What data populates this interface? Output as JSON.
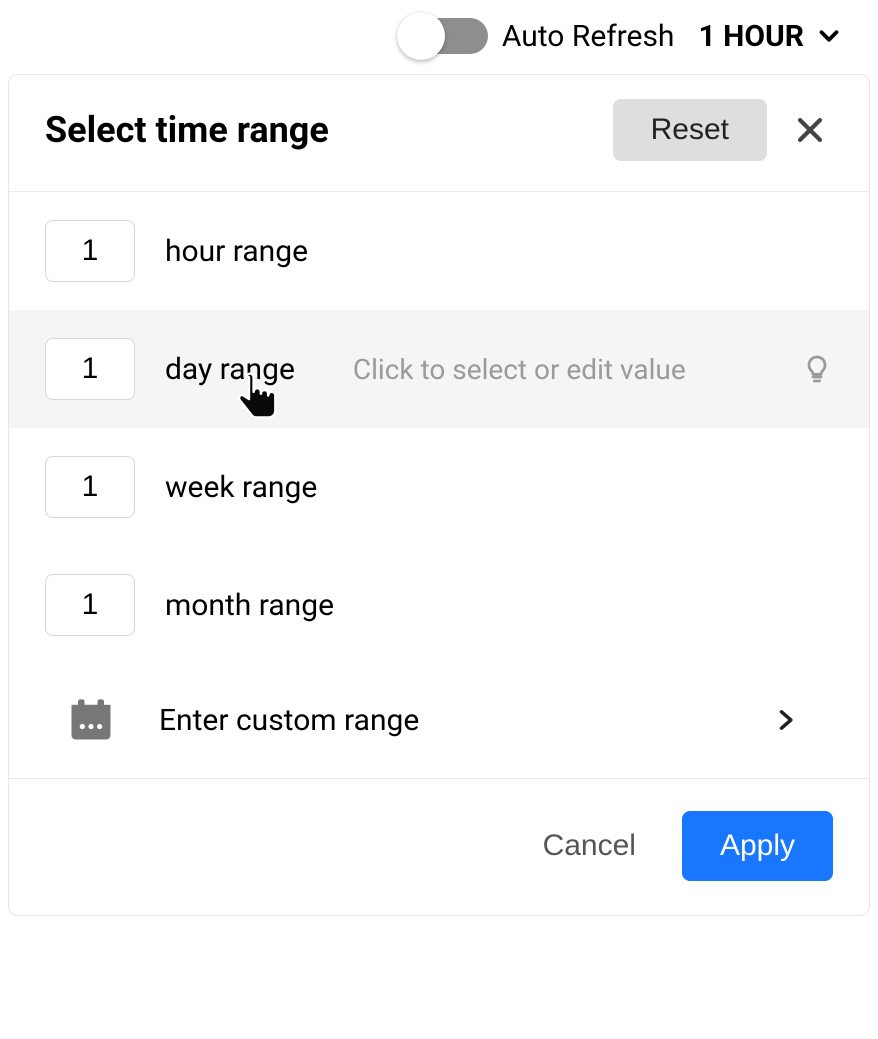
{
  "topbar": {
    "auto_refresh_label": "Auto Refresh",
    "auto_refresh_on": false,
    "time_selected": "1 HOUR"
  },
  "panel": {
    "title": "Select time range",
    "reset_label": "Reset",
    "rows": [
      {
        "value": "1",
        "label": "hour range"
      },
      {
        "value": "1",
        "label": "day range"
      },
      {
        "value": "1",
        "label": "week range"
      },
      {
        "value": "1",
        "label": "month range"
      }
    ],
    "hovered_index": 1,
    "hover_hint": "Click to select or edit value",
    "custom_label": "Enter custom range"
  },
  "footer": {
    "cancel_label": "Cancel",
    "apply_label": "Apply"
  }
}
